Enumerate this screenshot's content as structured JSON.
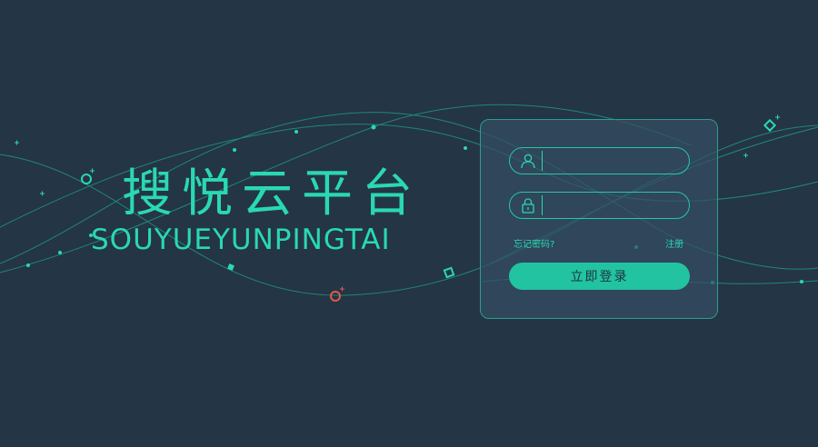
{
  "brand": {
    "title": "搜悦云平台",
    "subtitle": "SOUYUEYUNPINGTAI"
  },
  "login": {
    "username": {
      "icon": "user-icon",
      "value": "",
      "placeholder": ""
    },
    "password": {
      "icon": "lock-icon",
      "value": "",
      "placeholder": ""
    },
    "forgot_label": "忘记密码?",
    "register_label": "注册",
    "submit_label": "立即登录"
  },
  "colors": {
    "background": "#243545",
    "accent": "#2ad8b4",
    "button": "#22c3a0",
    "marker_red": "#e05a4a"
  }
}
